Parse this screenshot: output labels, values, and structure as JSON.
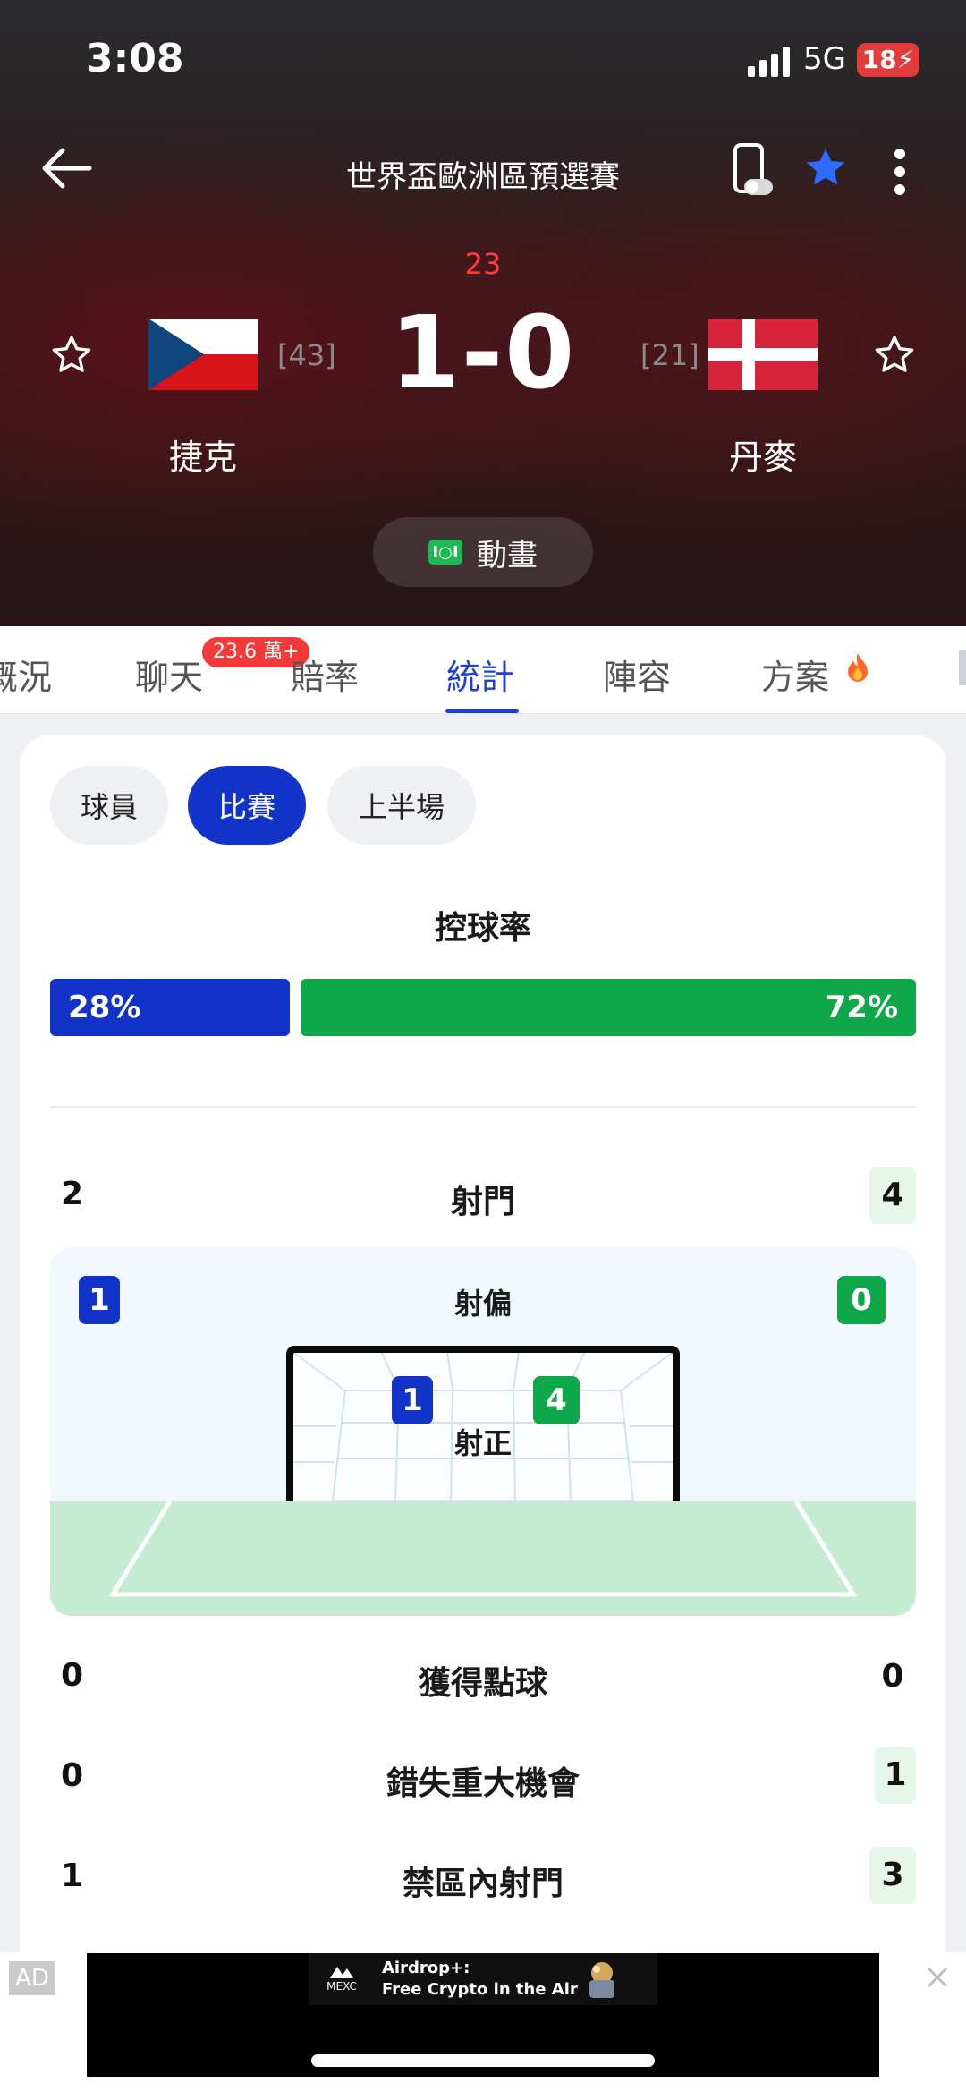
{
  "status": {
    "time": "3:08",
    "network": "5G",
    "battery": "18"
  },
  "nav": {
    "title": "世界盃歐洲區預選賽"
  },
  "match": {
    "minute": "23",
    "score": "1-0",
    "home": {
      "name": "捷克",
      "rank": "[43]"
    },
    "away": {
      "name": "丹麥",
      "rank": "[21]"
    },
    "animation_label": "動畫"
  },
  "tabs": [
    {
      "label": "概況"
    },
    {
      "label": "聊天"
    },
    {
      "label": "賠率"
    },
    {
      "label": "統計"
    },
    {
      "label": "陣容"
    },
    {
      "label": "方案"
    }
  ],
  "active_tab": "統計",
  "chat_badge": "23.6 萬+",
  "filters": [
    {
      "label": "球員"
    },
    {
      "label": "比賽"
    },
    {
      "label": "上半場"
    }
  ],
  "active_filter": "比賽",
  "possession": {
    "title": "控球率",
    "home": "28%",
    "away": "72%",
    "home_fraction": 0.28
  },
  "stats": {
    "shots": {
      "label": "射門",
      "home": "2",
      "away": "4"
    },
    "off_target": {
      "label": "射偏",
      "home": "1",
      "away": "0"
    },
    "on_target": {
      "label": "射正",
      "home": "1",
      "away": "4"
    },
    "penalties": {
      "label": "獲得點球",
      "home": "0",
      "away": "0"
    },
    "big_chances_missed": {
      "label": "錯失重大機會",
      "home": "0",
      "away": "1"
    },
    "shots_in_box": {
      "label": "禁區內射門",
      "home": "1",
      "away": "3"
    }
  },
  "ad": {
    "tag": "AD",
    "brand": "MEXC",
    "headline": "Airdrop+:",
    "subline": "Free Crypto in the Air"
  },
  "colors": {
    "blue": "#1233c8",
    "green": "#0ea84a",
    "live_red": "#ff3b3b"
  }
}
